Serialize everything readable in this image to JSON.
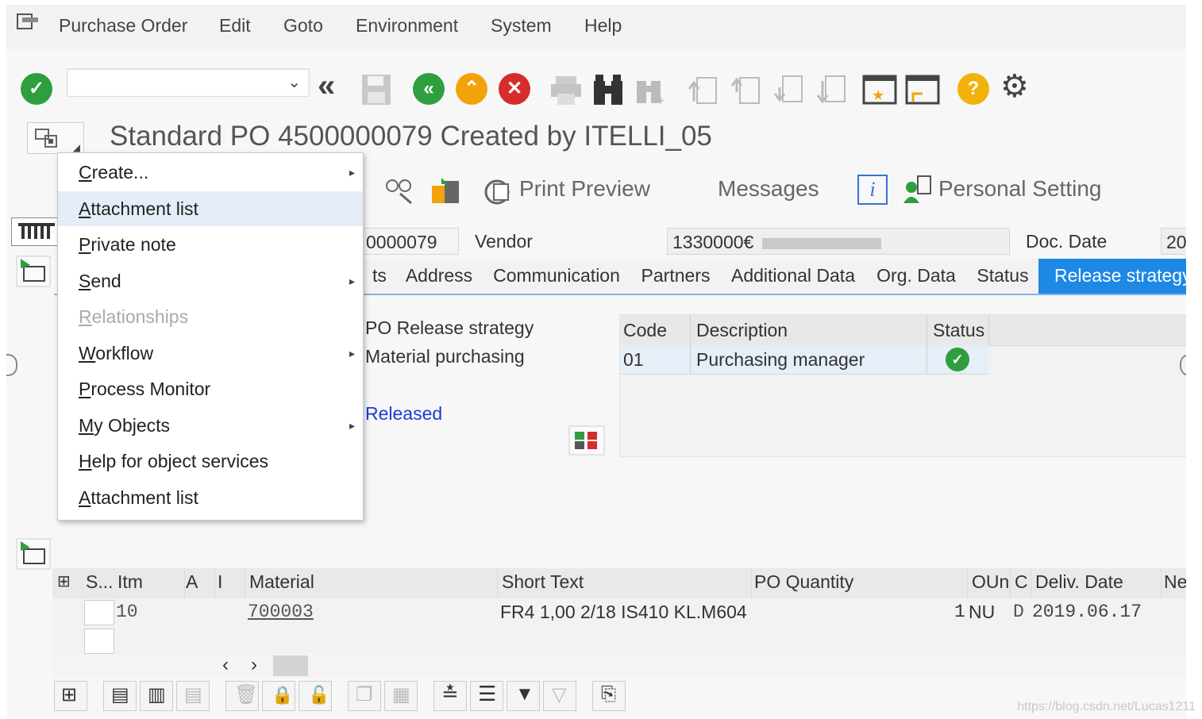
{
  "menubar": {
    "items": [
      "Purchase Order",
      "Edit",
      "Goto",
      "Environment",
      "System",
      "Help"
    ]
  },
  "toolbar": {
    "command_value": "",
    "icons": [
      "enter-icon",
      "back-icon",
      "save-icon",
      "back-green-icon",
      "exit-icon",
      "cancel-icon",
      "print-icon",
      "find-icon",
      "find-next-icon",
      "first-page-icon",
      "previous-page-icon",
      "next-page-icon",
      "last-page-icon",
      "create-session-icon",
      "shortcut-icon",
      "help-icon",
      "settings-icon"
    ]
  },
  "title": "Standard PO 4500000079 Created by ITELLI_05",
  "app_toolbar": {
    "print_preview": "Print Preview",
    "messages": "Messages",
    "personal_setting": "Personal Setting"
  },
  "header": {
    "po_number_partial": "0000079",
    "vendor_label": "Vendor",
    "vendor_value": "1330000€",
    "doc_date_label": "Doc. Date",
    "doc_date_value": "20"
  },
  "tabs": [
    "ts",
    "Address",
    "Communication",
    "Partners",
    "Additional Data",
    "Org. Data",
    "Status",
    "Release strategy"
  ],
  "release": {
    "strategy_label": "PO Release strategy",
    "group_label": "Material purchasing",
    "status_text": "Released",
    "table": {
      "headers": [
        "Code",
        "Description",
        "Status"
      ],
      "rows": [
        {
          "code": "01",
          "description": "Purchasing manager",
          "status": "released"
        }
      ]
    }
  },
  "context_menu": {
    "items": [
      {
        "label": "Create...",
        "mnemonic": "C",
        "submenu": true,
        "disabled": false
      },
      {
        "label": "Attachment list",
        "mnemonic": "A",
        "submenu": false,
        "disabled": false
      },
      {
        "label": "Private note",
        "mnemonic": "P",
        "submenu": false,
        "disabled": false
      },
      {
        "label": "Send",
        "mnemonic": "S",
        "submenu": true,
        "disabled": false
      },
      {
        "label": "Relationships",
        "mnemonic": "R",
        "submenu": false,
        "disabled": true
      },
      {
        "label": "Workflow",
        "mnemonic": "W",
        "submenu": true,
        "disabled": false
      },
      {
        "label": "Process Monitor",
        "mnemonic": "P",
        "submenu": false,
        "disabled": false
      },
      {
        "label": "My Objects",
        "mnemonic": "M",
        "submenu": true,
        "disabled": false
      },
      {
        "label": "Help for object services",
        "mnemonic": "H",
        "submenu": false,
        "disabled": false
      },
      {
        "label": "Attachment list",
        "mnemonic": "A",
        "submenu": false,
        "disabled": false
      }
    ]
  },
  "items_table": {
    "headers": [
      "S...",
      "Itm",
      "A",
      "I",
      "Material",
      "Short Text",
      "PO Quantity",
      "OUn",
      "C",
      "Deliv. Date",
      "Ne"
    ],
    "rows": [
      {
        "itm": "10",
        "material": "700003",
        "short_text": "FR4 1,00 2/18 IS410 KL.M604",
        "qty": "1",
        "oun": "NU",
        "c": "D",
        "deliv_date": "2019.06.17"
      }
    ]
  },
  "watermark": "https://blog.csdn.net/Lucas1211"
}
